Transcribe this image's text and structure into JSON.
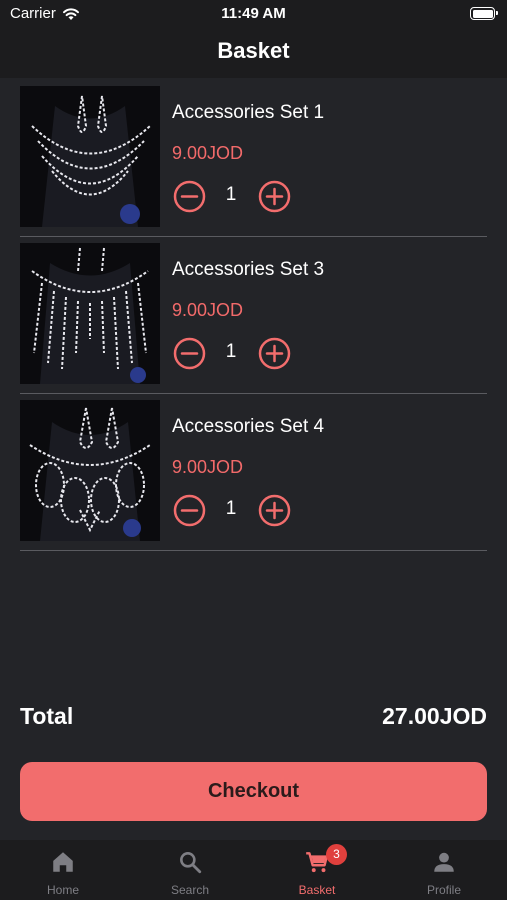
{
  "status_bar": {
    "carrier": "Carrier",
    "time": "11:49 AM"
  },
  "header": {
    "title": "Basket"
  },
  "items": [
    {
      "name": "Accessories Set 1",
      "price": "9.00JOD",
      "quantity": "1"
    },
    {
      "name": "Accessories Set 3",
      "price": "9.00JOD",
      "quantity": "1"
    },
    {
      "name": "Accessories Set 4",
      "price": "9.00JOD",
      "quantity": "1"
    }
  ],
  "summary": {
    "total_label": "Total",
    "total_value": "27.00JOD"
  },
  "checkout": {
    "label": "Checkout"
  },
  "tab_bar": {
    "tabs": [
      {
        "label": "Home",
        "icon": "home-icon"
      },
      {
        "label": "Search",
        "icon": "search-icon"
      },
      {
        "label": "Basket",
        "icon": "cart-icon",
        "badge": "3",
        "active": true
      },
      {
        "label": "Profile",
        "icon": "person-icon"
      }
    ]
  },
  "colors": {
    "accent": "#f26d6d",
    "price": "#f26a6a",
    "background": "#232428",
    "bar_background": "#1c1c1e",
    "badge": "#e0403d"
  }
}
